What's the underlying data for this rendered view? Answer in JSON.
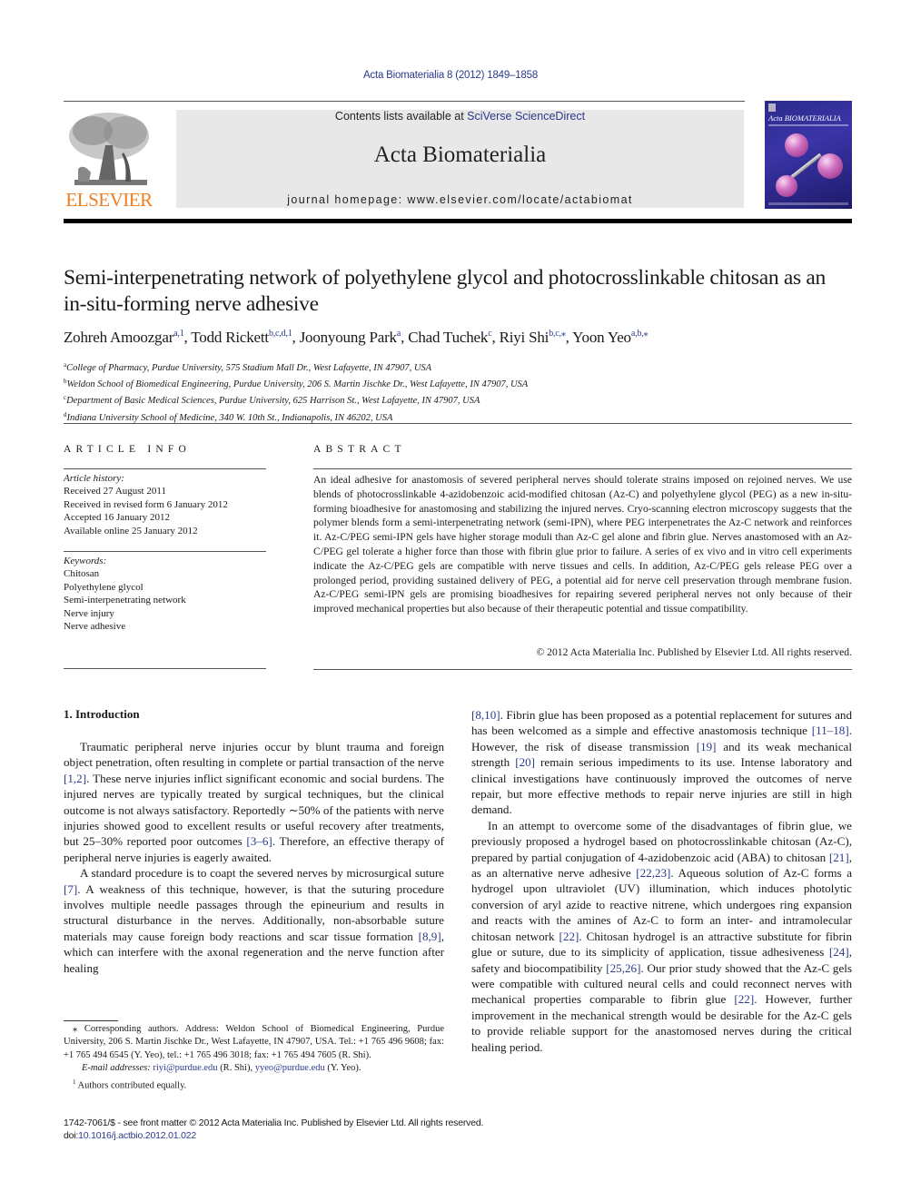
{
  "journal_ref": "Acta Biomaterialia 8 (2012) 1849–1858",
  "header": {
    "publisher_logo": "ELSEVIER",
    "contents_prefix": "Contents lists available at ",
    "contents_link": "SciVerse ScienceDirect",
    "journal_name": "Acta Biomaterialia",
    "homepage_prefix": "journal homepage: ",
    "homepage_url": "www.elsevier.com/locate/actabiomat",
    "cover_title": "Acta BIOMATERIALIA",
    "publisher_color": "#f07d20",
    "link_color": "#2a3a8c"
  },
  "article": {
    "title": "Semi-interpenetrating network of polyethylene glycol and photocrosslinkable chitosan as an in-situ-forming nerve adhesive",
    "authors": [
      {
        "name": "Zohreh Amoozgar",
        "sup": "a,1"
      },
      {
        "name": "Todd Rickett",
        "sup": "b,c,d,1"
      },
      {
        "name": "Joonyoung Park",
        "sup": "a"
      },
      {
        "name": "Chad Tuchek",
        "sup": "c"
      },
      {
        "name": "Riyi Shi",
        "sup": "b,c,⁎"
      },
      {
        "name": "Yoon Yeo",
        "sup": "a,b,⁎"
      }
    ],
    "affiliations": [
      {
        "key": "a",
        "text": "College of Pharmacy, Purdue University, 575 Stadium Mall Dr., West Lafayette, IN 47907, USA"
      },
      {
        "key": "b",
        "text": "Weldon School of Biomedical Engineering, Purdue University, 206 S. Martin Jischke Dr., West Lafayette, IN 47907, USA"
      },
      {
        "key": "c",
        "text": "Department of Basic Medical Sciences, Purdue University, 625 Harrison St., West Lafayette, IN 47907, USA"
      },
      {
        "key": "d",
        "text": "Indiana University School of Medicine, 340 W. 10th St., Indianapolis, IN 46202, USA"
      }
    ]
  },
  "article_info": {
    "heading": "ARTICLE INFO",
    "history_label": "Article history:",
    "history": [
      "Received 27 August 2011",
      "Received in revised form 6 January 2012",
      "Accepted 16 January 2012",
      "Available online 25 January 2012"
    ],
    "keywords_label": "Keywords:",
    "keywords": [
      "Chitosan",
      "Polyethylene glycol",
      "Semi-interpenetrating network",
      "Nerve injury",
      "Nerve adhesive"
    ]
  },
  "abstract": {
    "heading": "ABSTRACT",
    "text": "An ideal adhesive for anastomosis of severed peripheral nerves should tolerate strains imposed on rejoined nerves. We use blends of photocrosslinkable 4-azidobenzoic acid-modified chitosan (Az-C) and polyethylene glycol (PEG) as a new in-situ-forming bioadhesive for anastomosing and stabilizing the injured nerves. Cryo-scanning electron microscopy suggests that the polymer blends form a semi-interpenetrating network (semi-IPN), where PEG interpenetrates the Az-C network and reinforces it. Az-C/PEG semi-IPN gels have higher storage moduli than Az-C gel alone and fibrin glue. Nerves anastomosed with an Az-C/PEG gel tolerate a higher force than those with fibrin glue prior to failure. A series of ex vivo and in vitro cell experiments indicate the Az-C/PEG gels are compatible with nerve tissues and cells. In addition, Az-C/PEG gels release PEG over a prolonged period, providing sustained delivery of PEG, a potential aid for nerve cell preservation through membrane fusion. Az-C/PEG semi-IPN gels are promising bioadhesives for repairing severed peripheral nerves not only because of their improved mechanical properties but also because of their therapeutic potential and tissue compatibility.",
    "copyright": "© 2012 Acta Materialia Inc. Published by Elsevier Ltd. All rights reserved."
  },
  "introduction": {
    "heading": "1. Introduction",
    "left_paragraphs": [
      [
        {
          "t": "Traumatic peripheral nerve injuries occur by blunt trauma and foreign object penetration, often resulting in complete or partial transaction of the nerve "
        },
        {
          "ref": "[1,2]"
        },
        {
          "t": ". These nerve injuries inflict significant economic and social burdens. The injured nerves are typically treated by surgical techniques, but the clinical outcome is not always satisfactory. Reportedly ∼50% of the patients with nerve injuries showed good to excellent results or useful recovery after treatments, but 25–30% reported poor outcomes "
        },
        {
          "ref": "[3–6]"
        },
        {
          "t": ". Therefore, an effective therapy of peripheral nerve injuries is eagerly awaited."
        }
      ],
      [
        {
          "t": "A standard procedure is to coapt the severed nerves by microsurgical suture "
        },
        {
          "ref": "[7]"
        },
        {
          "t": ". A weakness of this technique, however, is that the suturing procedure involves multiple needle passages through the epineurium and results in structural disturbance in the nerves. Additionally, non-absorbable suture materials may cause foreign body reactions and scar tissue formation "
        },
        {
          "ref": "[8,9]"
        },
        {
          "t": ", which can interfere with the axonal regeneration and the nerve function after healing"
        }
      ]
    ],
    "right_paragraphs": [
      [
        {
          "ref": "[8,10]"
        },
        {
          "t": ". Fibrin glue has been proposed as a potential replacement for sutures and has been welcomed as a simple and effective anastomosis technique "
        },
        {
          "ref": "[11–18]"
        },
        {
          "t": ". However, the risk of disease transmission "
        },
        {
          "ref": "[19]"
        },
        {
          "t": " and its weak mechanical strength "
        },
        {
          "ref": "[20]"
        },
        {
          "t": " remain serious impediments to its use. Intense laboratory and clinical investigations have continuously improved the outcomes of nerve repair, but more effective methods to repair nerve injuries are still in high demand."
        }
      ],
      [
        {
          "t": "In an attempt to overcome some of the disadvantages of fibrin glue, we previously proposed a hydrogel based on photocrosslinkable chitosan (Az-C), prepared by partial conjugation of 4-azidobenzoic acid (ABA) to chitosan "
        },
        {
          "ref": "[21]"
        },
        {
          "t": ", as an alternative nerve adhesive "
        },
        {
          "ref": "[22,23]"
        },
        {
          "t": ". Aqueous solution of Az-C forms a hydrogel upon ultraviolet (UV) illumination, which induces photolytic conversion of aryl azide to reactive nitrene, which undergoes ring expansion and reacts with the amines of Az-C to form an inter- and intramolecular chitosan network "
        },
        {
          "ref": "[22]"
        },
        {
          "t": ". Chitosan hydrogel is an attractive substitute for fibrin glue or suture, due to its simplicity of application, tissue adhesiveness "
        },
        {
          "ref": "[24]"
        },
        {
          "t": ", safety and biocompatibility "
        },
        {
          "ref": "[25,26]"
        },
        {
          "t": ". Our prior study showed that the Az-C gels were compatible with cultured neural cells and could reconnect nerves with mechanical properties comparable to fibrin glue "
        },
        {
          "ref": "[22]"
        },
        {
          "t": ". However, further improvement in the mechanical strength would be desirable for the Az-C gels to provide reliable support for the anastomosed nerves during the critical healing period."
        }
      ]
    ]
  },
  "footnotes": {
    "corresponding_mark": "⁎",
    "corresponding": "Corresponding authors. Address: Weldon School of Biomedical Engineering, Purdue University, 206 S. Martin Jischke Dr., West Lafayette, IN 47907, USA. Tel.: +1 765 496 9608; fax: +1 765 494 6545 (Y. Yeo), tel.: +1 765 496 3018; fax: +1 765 494 7605 (R. Shi).",
    "email_label": "E-mail addresses:",
    "emails": [
      {
        "address": "riyi@purdue.edu",
        "who": " (R. Shi), "
      },
      {
        "address": "yyeo@purdue.edu",
        "who": " (Y. Yeo)."
      }
    ],
    "equal_mark": "1",
    "equal": "Authors contributed equally."
  },
  "bottom": {
    "issn_line": "1742-7061/$ - see front matter © 2012 Acta Materialia Inc. Published by Elsevier Ltd. All rights reserved.",
    "doi_prefix": "doi:",
    "doi": "10.1016/j.actbio.2012.01.022"
  }
}
